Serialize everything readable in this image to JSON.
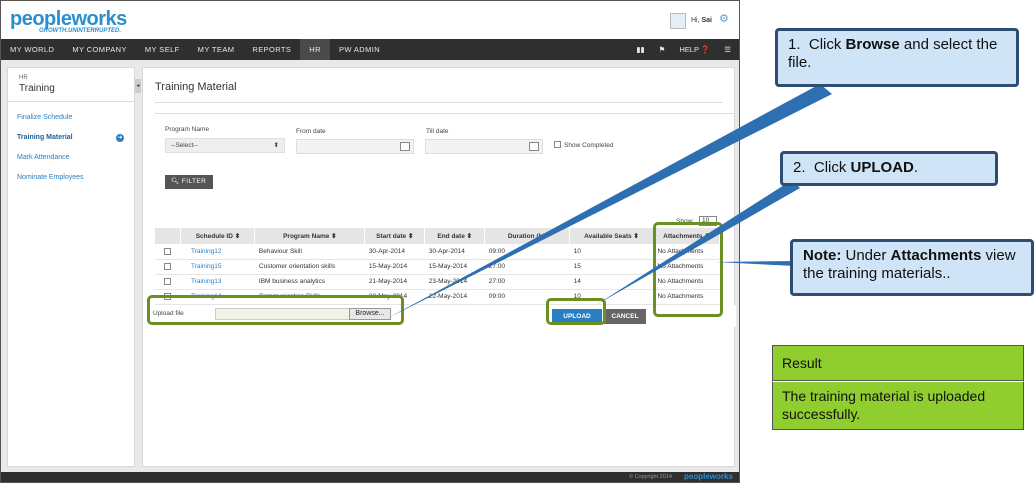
{
  "app": {
    "logo_main": "peopleworks",
    "tagline": "GROWTH.UNINTERRUPTED.",
    "greeting_prefix": "Hi, ",
    "user_name": "Sai"
  },
  "nav": {
    "items": [
      "MY WORLD",
      "MY COMPANY",
      "MY SELF",
      "MY TEAM",
      "REPORTS",
      "HR",
      "PW ADMIN"
    ],
    "active": "HR",
    "help": "HELP"
  },
  "sidebar": {
    "module": "HR",
    "title": "Training",
    "items": [
      "Finalize Schedule",
      "Training Material",
      "Mark Attendance",
      "Nominate Employees"
    ],
    "active": "Training Material"
  },
  "page": {
    "title": "Training Material",
    "filters": {
      "program_label": "Program Name",
      "program_value": "--Select--",
      "from_label": "From date",
      "till_label": "Till date",
      "show_completed": "Show Completed",
      "filter_button": "FILTER"
    },
    "show_label": "Show:",
    "show_value": "10",
    "table": {
      "headers": [
        "Schedule ID",
        "Program Name",
        "Start date",
        "End date",
        "Duration (hh",
        "Available Seats",
        "Attachments"
      ],
      "rows": [
        [
          "Training12",
          "Behaviour Skill",
          "30-Apr-2014",
          "30-Apr-2014",
          "09:00",
          "10",
          "No Attachments"
        ],
        [
          "Training15",
          "Customer orientation skills",
          "15-May-2014",
          "15-May-2014",
          "27:00",
          "15",
          "No Attachments"
        ],
        [
          "Training13",
          "IBM business analytics",
          "21-May-2014",
          "23-May-2014",
          "27:00",
          "14",
          "No Attachments"
        ],
        [
          "Training14",
          "Communication Skills",
          "22-May-2014",
          "22-May-2014",
          "09:00",
          "10",
          "No Attachments"
        ]
      ]
    },
    "upload": {
      "label": "Upload file",
      "browse": "Browse...",
      "upload_button": "UPLOAD",
      "cancel_button": "CANCEL"
    },
    "footer": {
      "copyright": "© Copyright 2014",
      "logo": "peopleworks"
    }
  },
  "callouts": {
    "step1_num": "1.",
    "step1_pre": "Click ",
    "step1_bold": "Browse",
    "step1_post": " and select the file.",
    "step2_num": "2.",
    "step2_pre": "Click ",
    "step2_bold": "UPLOAD",
    "step2_post": ".",
    "note_bold1": "Note:",
    "note_mid": " Under ",
    "note_bold2": "Attachments",
    "note_post": " view the training materials.."
  },
  "result": {
    "heading": "Result",
    "text": "The training material is uploaded successfully."
  },
  "colors": {
    "brand_blue": "#2a8fce",
    "brand_green": "#8dc63f",
    "highlight_green": "#6b8f23",
    "callout_fill": "#cfe4f6",
    "callout_border": "#2d4e72",
    "result_fill": "#8fce2e"
  }
}
